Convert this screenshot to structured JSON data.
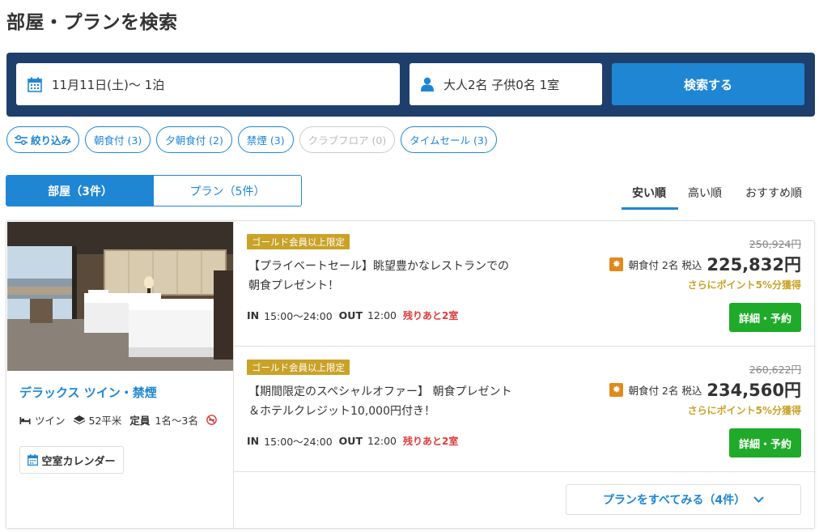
{
  "page_title": "部屋・プランを検索",
  "search": {
    "date_value": "11月11日(土)〜 1泊",
    "guests_value": "大人2名 子供0名 1室",
    "submit_label": "検索する"
  },
  "filters": {
    "refine_label": "絞り込み",
    "chips": [
      {
        "label": "朝食付 (3)",
        "enabled": true
      },
      {
        "label": "夕朝食付 (2)",
        "enabled": true
      },
      {
        "label": "禁煙 (3)",
        "enabled": true
      },
      {
        "label": "クラブフロア (0)",
        "enabled": false
      },
      {
        "label": "タイムセール (3)",
        "enabled": true
      }
    ]
  },
  "tabs": {
    "rooms": "部屋（3件）",
    "plans": "プラン（5件）"
  },
  "sort": {
    "options": [
      "安い順",
      "高い順",
      "おすすめ順"
    ],
    "selected": "安い順"
  },
  "room": {
    "name": "デラックス ツイン・禁煙",
    "bed": "ツイン",
    "area": "52平米",
    "capacity_label": "定員",
    "capacity": "1名〜3名",
    "calendar_label": "空室カレンダー",
    "plans": [
      {
        "badge": "ゴールド会員以上限定",
        "title_line1": "【プライベートセール】眺望豊かなレストランでの",
        "title_line2": "朝食プレゼント！",
        "in_label": "IN",
        "in_time": "15:00〜24:00",
        "out_label": "OUT",
        "out_time": "12:00",
        "remaining": "残りあと2室",
        "original_price": "250,924円",
        "meal_guests": "朝食付 2名 税込",
        "price": "225,832円",
        "points": "さらにポイント5%分獲得",
        "detail_label": "詳細・予約"
      },
      {
        "badge": "ゴールド会員以上限定",
        "title_line1": "【期間限定のスペシャルオファー】 朝食プレゼント",
        "title_line2": "＆ホテルクレジット10,000円付き！",
        "in_label": "IN",
        "in_time": "15:00〜24:00",
        "out_label": "OUT",
        "out_time": "12:00",
        "remaining": "残りあと2室",
        "original_price": "260,622円",
        "meal_guests": "朝食付 2名 税込",
        "price": "234,560円",
        "points": "さらにポイント5%分獲得",
        "detail_label": "詳細・予約"
      }
    ],
    "see_all_label": "プランをすべてみる（4件）"
  },
  "colors": {
    "navy": "#1e3f6c",
    "primary_blue": "#1f86d4",
    "gold": "#c9a227",
    "green": "#1faa2a",
    "red": "#e03a3a"
  }
}
